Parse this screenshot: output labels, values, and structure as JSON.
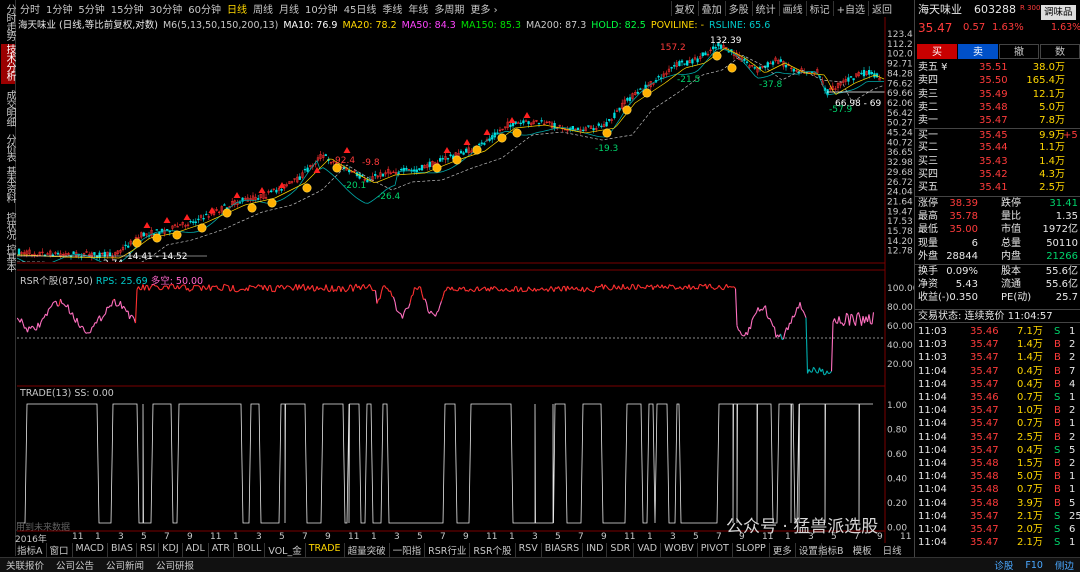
{
  "left_nav": [
    "分时走势",
    "技术分析",
    "成交明细",
    "分价表",
    "基本资料",
    "控状况",
    "控基本"
  ],
  "toolbar": {
    "periods": [
      "分时",
      "1分钟",
      "5分钟",
      "15分钟",
      "30分钟",
      "60分钟",
      "日线",
      "周线",
      "月线",
      "10分钟",
      "45日线",
      "季线",
      "年线",
      "多周期",
      "更多 ›"
    ],
    "active": "日线",
    "tools": [
      "复权",
      "叠加",
      "多股",
      "统计",
      "画线",
      "标记",
      "+自选",
      "返回"
    ]
  },
  "legend": {
    "name": "海天味业 (日线,等比前复权,对数)",
    "items": [
      {
        "t": "M6(5,13,50,150,200,13)",
        "c": "#c8c8c8"
      },
      {
        "t": "MA10: 76.9",
        "c": "#ffffff"
      },
      {
        "t": "MA20: 78.2",
        "c": "#ffd700"
      },
      {
        "t": "MA50: 84.3",
        "c": "#ff44ff"
      },
      {
        "t": "MA150: 85.3",
        "c": "#00e000"
      },
      {
        "t": "MA200: 87.3",
        "c": "#c8c8c8"
      },
      {
        "t": "HOLD: 82.5",
        "c": "#00ff40"
      },
      {
        "t": "POVILINE: -",
        "c": "#ffd700"
      },
      {
        "t": "RSLINE: 65.6",
        "c": "#00c8c8"
      }
    ]
  },
  "price_scale": [
    "123.4",
    "112.2",
    "102.0",
    "92.71",
    "84.28",
    "76.62",
    "69.66",
    "62.06",
    "56.42",
    "50.27",
    "45.24",
    "40.72",
    "36.65",
    "32.98",
    "29.68",
    "26.72",
    "24.04",
    "21.64",
    "19.47",
    "17.53",
    "15.78",
    "14.20",
    "12.78"
  ],
  "chart_labels": {
    "high": "132.39",
    "p1": "157.2",
    "p2": "-21.5",
    "p3": "-37.8",
    "p4": "-19.3",
    "p5": "-20.1",
    "p6": "-26.4",
    "p7": "92.4",
    "p8": "-9.8",
    "p9": "66.98 - 69",
    "p10": "-57.9",
    "low": "14.41 - 14.52",
    "low2": "2.74"
  },
  "rsr": {
    "title": "RSR个股(87,50)",
    "rps": "RPS: 25.69",
    "ks": "多空: 50.00",
    "scale": [
      "100.00",
      "80.00",
      "60.00",
      "40.00",
      "20.00"
    ]
  },
  "trade": {
    "title": "TRADE(13)",
    "ss": "SS: 0.00",
    "scale": [
      "1.00",
      "0.80",
      "0.60",
      "0.40",
      "0.20",
      "0.00"
    ]
  },
  "watermark": "用到未来数据",
  "xaxis": {
    "year": "2016年",
    "ticks": [
      "11",
      "1",
      "3",
      "5",
      "7",
      "9",
      "11",
      "1",
      "3",
      "5",
      "7",
      "9",
      "11",
      "1",
      "3",
      "5",
      "7",
      "9",
      "11",
      "1",
      "3",
      "5",
      "7",
      "9",
      "11",
      "1",
      "3",
      "5",
      "7",
      "9",
      "11",
      "1",
      "3",
      "5",
      "7",
      "9",
      "11",
      "1",
      "3"
    ]
  },
  "bottom_tabs": [
    "指标A",
    "窗口",
    "MACD",
    "BIAS",
    "RSI",
    "KDJ",
    "ADL",
    "ATR",
    "BOLL",
    "VOL_金",
    "TRADE",
    "超量突破",
    "一阳指",
    "RSR行业",
    "RSR个股",
    "RSV",
    "BIASRS",
    "IND",
    "SDR",
    "VAD",
    "WOBV",
    "PIVOT",
    "SLOPP",
    "更多",
    "设置"
  ],
  "bottom_active": "TRADE",
  "bottom_right": [
    "指标B",
    "模板",
    "日线"
  ],
  "statusbar": [
    "关联报价",
    "公司公告",
    "公司新闻",
    "公司研报"
  ],
  "status_right": [
    "诊股",
    "F10",
    "侧边"
  ],
  "right_panel": {
    "name": "海天味业",
    "code": "603288",
    "r": "R 300",
    "tag": "调味品",
    "price": "35.47",
    "chg": "0.57",
    "pct": "1.63%",
    "pct2": "1.63%",
    "btns": [
      "买",
      "卖",
      "撤",
      "数"
    ],
    "asks": [
      [
        "卖五 ¥",
        "35.51",
        "38.0万"
      ],
      [
        "卖四",
        "35.50",
        "165.4万"
      ],
      [
        "卖三",
        "35.49",
        "12.1万"
      ],
      [
        "卖二",
        "35.48",
        "5.0万"
      ],
      [
        "卖一",
        "35.47",
        "7.8万"
      ]
    ],
    "bids": [
      [
        "买一",
        "35.45",
        "9.9万",
        "+5"
      ],
      [
        "买二",
        "35.44",
        "1.1万",
        ""
      ],
      [
        "买三",
        "35.43",
        "1.4万",
        ""
      ],
      [
        "买四",
        "35.42",
        "4.3万",
        ""
      ],
      [
        "买五",
        "35.41",
        "2.5万",
        ""
      ]
    ],
    "stats": [
      [
        "涨停",
        "38.39",
        "跌停",
        "31.41"
      ],
      [
        "最高",
        "35.78",
        "量比",
        "1.35"
      ],
      [
        "最低",
        "35.00",
        "市值",
        "1972亿"
      ],
      [
        "现量",
        "6",
        "总量",
        "50110"
      ],
      [
        "外盘",
        "28844",
        "内盘",
        "21266"
      ]
    ],
    "stats2": [
      [
        "换手",
        "0.09%",
        "股本",
        "55.6亿"
      ],
      [
        "净资",
        "5.43",
        "流通",
        "55.6亿"
      ],
      [
        "收益(-)",
        "0.350",
        "PE(动)",
        "25.7"
      ]
    ],
    "trade_state": "交易状态: 连续竞价 11:04:57",
    "ticks": [
      [
        "11:03",
        "35.46",
        "7.1万",
        "S"
      ],
      [
        "11:03",
        "35.47",
        "1.4万",
        "B"
      ],
      [
        "11:03",
        "35.47",
        "1.4万",
        "B"
      ],
      [
        "11:04",
        "35.47",
        "0.4万",
        "B"
      ],
      [
        "11:04",
        "35.47",
        "0.4万",
        "B"
      ],
      [
        "11:04",
        "35.46",
        "0.7万",
        "S"
      ],
      [
        "11:04",
        "35.47",
        "1.0万",
        "B"
      ],
      [
        "11:04",
        "35.47",
        "0.7万",
        "B"
      ],
      [
        "11:04",
        "35.47",
        "2.5万",
        "B"
      ],
      [
        "11:04",
        "35.47",
        "0.4万",
        "S"
      ],
      [
        "11:04",
        "35.48",
        "1.5万",
        "B"
      ],
      [
        "11:04",
        "35.48",
        "5.0万",
        "B"
      ],
      [
        "11:04",
        "35.48",
        "0.7万",
        "B"
      ],
      [
        "11:04",
        "35.48",
        "3.9万",
        "B"
      ],
      [
        "11:04",
        "35.47",
        "2.1万",
        "S"
      ],
      [
        "11:04",
        "35.47",
        "2.0万",
        "S"
      ],
      [
        "11:04",
        "35.47",
        "2.1万",
        "S"
      ]
    ],
    "tick_sides": [
      "1",
      "2",
      "2",
      "7",
      "4",
      "1",
      "2",
      "1",
      "2",
      "5",
      "2",
      "1",
      "1",
      "5",
      "25",
      "6",
      "1"
    ]
  },
  "overlay_watermark": "公众号 · 猛兽派选股"
}
